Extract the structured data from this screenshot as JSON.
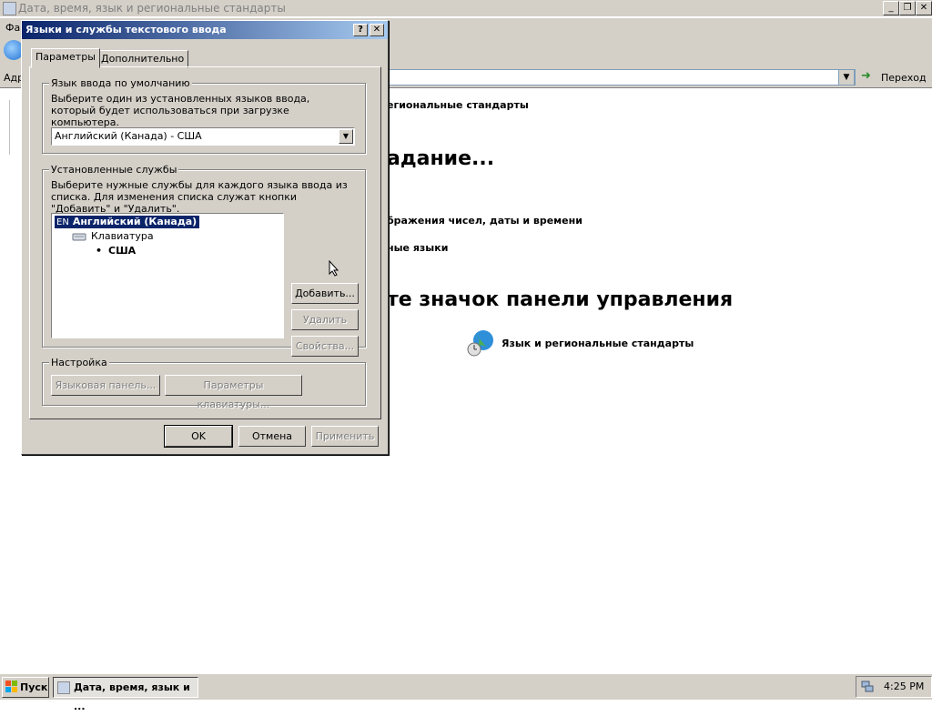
{
  "main_window": {
    "title": "Дата, время, язык и региональные стандарты",
    "menu_first": "Фа",
    "address_label": "Адр",
    "go_label": "Переход",
    "content": {
      "breadcrumb_fragment": "егиональные стандарты",
      "heading_task_fragment": "адание...",
      "task1_fragment": "бражения чисел, даты и времени",
      "task2_fragment": "ные языки",
      "heading_icon_fragment": "те значок панели управления",
      "icon_link_label": "Язык и региональные стандарты"
    }
  },
  "dialog": {
    "title": "Языки и службы текстового ввода",
    "help_glyph": "?",
    "close_glyph": "✕",
    "tabs": [
      {
        "label": "Параметры",
        "active": true
      },
      {
        "label": "Дополнительно",
        "active": false
      }
    ],
    "default_language": {
      "group_label": "Язык ввода по умолчанию",
      "description": "Выберите один из установленных языков ввода, который будет использоваться при загрузке компьютера.",
      "selected": "Английский (Канада) - США"
    },
    "installed_services": {
      "group_label": "Установленные службы",
      "description": "Выберите нужные службы для каждого языка ввода из списка. Для изменения списка служат кнопки \"Добавить\" и \"Удалить\".",
      "tree": {
        "language_code": "EN",
        "language": "Английский (Канада)",
        "category": "Клавиатура",
        "layout": "США"
      },
      "add_button": "Добавить...",
      "remove_button": "Удалить",
      "properties_button": "Свойства..."
    },
    "settings": {
      "group_label": "Настройка",
      "language_bar_button": "Языковая панель...",
      "keyboard_settings_button": "Параметры клавиатуры..."
    },
    "ok_button": "OK",
    "cancel_button": "Отмена",
    "apply_button": "Применить"
  },
  "taskbar": {
    "start_label": "Пуск",
    "task_label": "Дата, время, язык и ...",
    "clock": "4:25 PM"
  }
}
